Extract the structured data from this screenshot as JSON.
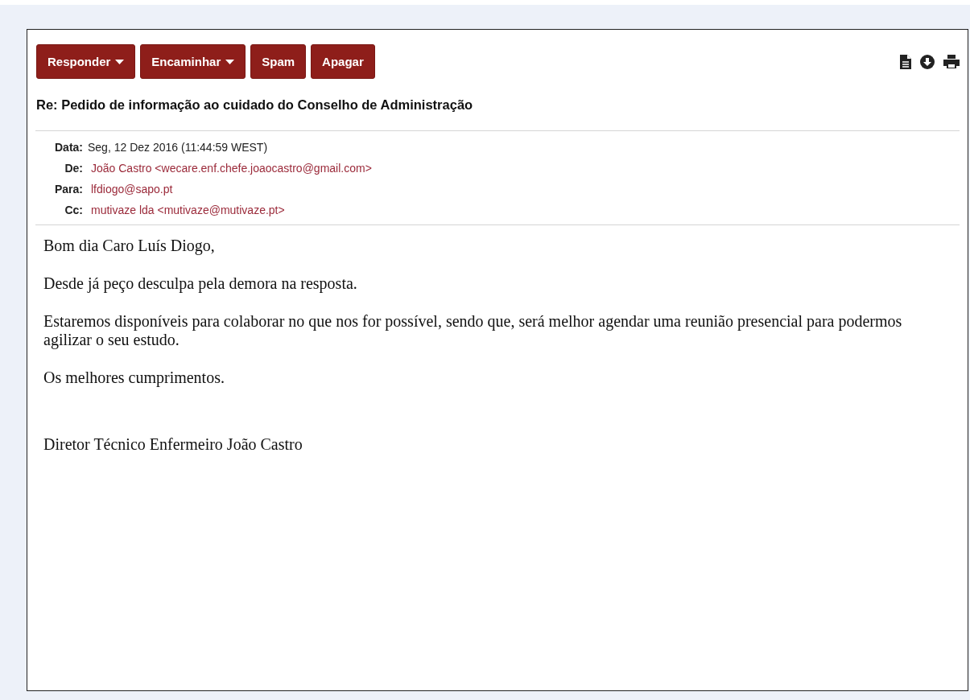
{
  "toolbar": {
    "buttons": [
      {
        "label": "Responder",
        "dropdown": true
      },
      {
        "label": "Encaminhar",
        "dropdown": true
      },
      {
        "label": "Spam",
        "dropdown": false
      },
      {
        "label": "Apagar",
        "dropdown": false
      }
    ]
  },
  "subject": "Re: Pedido de informação ao cuidado do Conselho de Administração",
  "headers": [
    {
      "label": "Data:",
      "value": "Seg, 12 Dez 2016 (11:44:59 WEST)",
      "kind": "text"
    },
    {
      "label": "De:",
      "value": "João Castro <wecare.enf.chefe.joaocastro@gmail.com>",
      "kind": "address"
    },
    {
      "label": "Para:",
      "value": "lfdiogo@sapo.pt",
      "kind": "address"
    },
    {
      "label": "Cc:",
      "value": "mutivaze lda <mutivaze@mutivaze.pt>",
      "kind": "address"
    }
  ],
  "body": {
    "paragraphs": [
      "Bom dia Caro Luís Diogo,",
      "Desde já peço desculpa pela demora na resposta.",
      "Estaremos disponíveis para colaborar no que nos for possível, sendo que, será melhor agendar uma reunião presencial para podermos agilizar o seu estudo.",
      "Os melhores cumprimentos."
    ],
    "signature": "Diretor Técnico Enfermeiro João Castro"
  }
}
